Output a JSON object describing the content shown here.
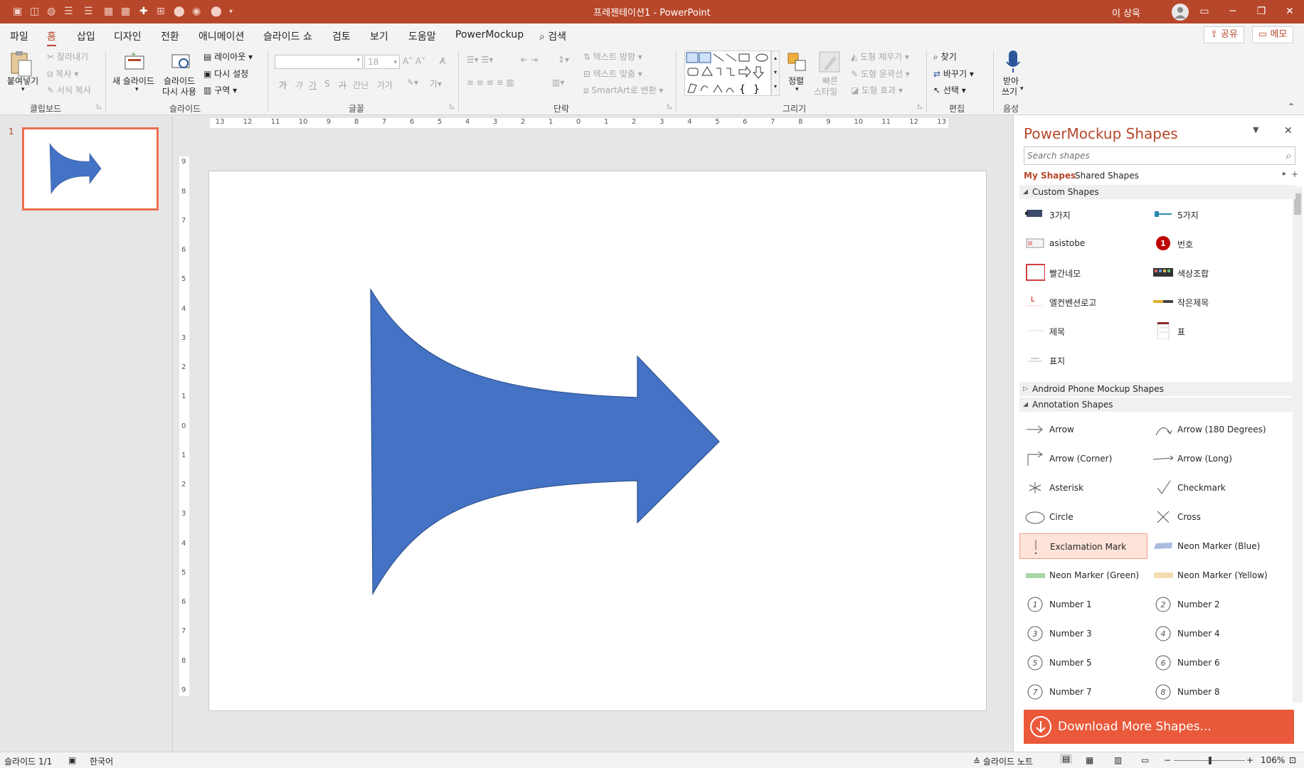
{
  "window": {
    "title": "프레젠테이션1  -  PowerPoint",
    "user": "이 상욱",
    "accent": "#b7472a"
  },
  "tabs": [
    "파일",
    "홈",
    "삽입",
    "디자인",
    "전환",
    "애니메이션",
    "슬라이드 쇼",
    "검토",
    "보기",
    "도움말",
    "PowerMockup"
  ],
  "search_tab": "검색",
  "share_label": "공유",
  "memo_label": "메모",
  "ribbon": {
    "clipboard": {
      "paste": "붙여넣기",
      "cut": "잘라내기",
      "copy": "복사",
      "format_painter": "서식 복사",
      "label": "클립보드"
    },
    "slides": {
      "new_slide": "새 슬라이드",
      "reuse_slide_1": "슬라이드",
      "reuse_slide_2": "다시 사용",
      "layout": "레이아웃",
      "reset": "다시 설정",
      "section": "구역",
      "label": "슬라이드"
    },
    "font": {
      "font_name": "",
      "font_size": "18",
      "bold": "가",
      "italic": "가",
      "underline": "가",
      "shadow": "S",
      "strike": "가",
      "spacing": "간닌",
      "case": "가가",
      "label": "글꼴"
    },
    "paragraph": {
      "text_direction": "텍스트 방향",
      "align_text": "텍스트 맞춤",
      "smartart": "SmartArt로 변환",
      "label": "단락"
    },
    "drawing": {
      "arrange": "정렬",
      "quick_styles_1": "빠른",
      "quick_styles_2": "스타일",
      "fill": "도형 채우기",
      "outline": "도형 윤곽선",
      "effects": "도형 효과",
      "label": "그리기"
    },
    "editing": {
      "find": "찾기",
      "replace": "바꾸기",
      "select": "선택",
      "label": "편집"
    },
    "voice": {
      "dictate_1": "받아",
      "dictate_2": "쓰기",
      "label": "음성"
    }
  },
  "thumbnail": {
    "number": "1"
  },
  "ruler": {
    "h_ticks": [
      "13",
      "12",
      "11",
      "10",
      "9",
      "8",
      "7",
      "6",
      "5",
      "4",
      "3",
      "2",
      "1",
      "0",
      "1",
      "2",
      "3",
      "4",
      "5",
      "6",
      "7",
      "8",
      "9",
      "10",
      "11",
      "12",
      "13"
    ],
    "v_ticks": [
      "9",
      "8",
      "7",
      "6",
      "5",
      "4",
      "3",
      "2",
      "1",
      "0",
      "1",
      "2",
      "3",
      "4",
      "5",
      "6",
      "7",
      "8",
      "9"
    ]
  },
  "slide": {
    "arrow_color": "#4472c4"
  },
  "taskpane": {
    "title": "PowerMockup Shapes",
    "search_placeholder": "Search shapes",
    "tab_my": "My Shapes",
    "tab_shared": "Shared Shapes",
    "sections": {
      "custom": "Custom Shapes",
      "android": "Android Phone Mockup Shapes",
      "annotation": "Annotation Shapes"
    },
    "custom_shapes": [
      "3가지",
      "5가지",
      "asistobe",
      "번호",
      "빨간네모",
      "색상조합",
      "엘컨벤션로고",
      "작은제목",
      "제목",
      "표",
      "표지"
    ],
    "numbered_badge": "1",
    "annotation_shapes": [
      "Arrow",
      "Arrow (180 Degrees)",
      "Arrow (Corner)",
      "Arrow (Long)",
      "Asterisk",
      "Checkmark",
      "Circle",
      "Cross",
      "Exclamation Mark",
      "Neon Marker (Blue)",
      "Neon Marker (Green)",
      "Neon Marker (Yellow)",
      "Number 1",
      "Number 2",
      "Number 3",
      "Number 4",
      "Number 5",
      "Number 6",
      "Number 7",
      "Number 8"
    ],
    "number_glyphs": [
      "1",
      "2",
      "3",
      "4",
      "5",
      "6",
      "7",
      "8"
    ],
    "download": "Download More Shapes..."
  },
  "status": {
    "slide_count": "슬라이드 1/1",
    "language": "한국어",
    "notes": "슬라이드 노트",
    "zoom": "106%"
  }
}
